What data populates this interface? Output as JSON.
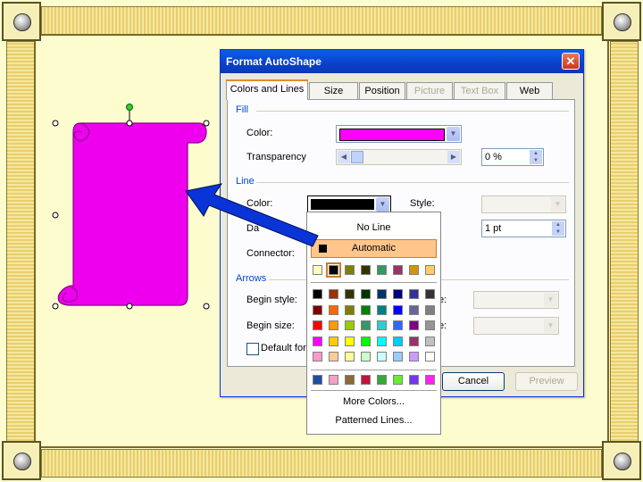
{
  "dialog": {
    "title": "Format AutoShape",
    "close_glyph": "✕",
    "tabs": [
      {
        "label": "Colors and Lines"
      },
      {
        "label": "Size"
      },
      {
        "label": "Position"
      },
      {
        "label": "Picture"
      },
      {
        "label": "Text Box"
      },
      {
        "label": "Web"
      }
    ],
    "fill": {
      "section": "Fill",
      "color_label": "Color:",
      "color_value": "#ff00ff",
      "transparency_label": "Transparency",
      "transparency_value": "0 %"
    },
    "line": {
      "section": "Line",
      "color_label": "Color:",
      "color_value": "#000000",
      "style_label": "Style:",
      "dashed_label": "Da",
      "weight_value": "1 pt",
      "connector_label": "Connector:"
    },
    "arrows": {
      "section": "Arrows",
      "begin_style_label": "Begin style:",
      "begin_size_label": "Begin size:",
      "end_style_suffix": "e:",
      "end_size_suffix": "e:"
    },
    "default_label": "Default for",
    "cancel_label": "Cancel",
    "preview_label": "Preview"
  },
  "palette": {
    "no_line": "No Line",
    "automatic": "Automatic",
    "more_colors": "More Colors...",
    "patterned_lines": "Patterned Lines...",
    "recent": [
      "#fffbc0",
      "#000000",
      "#808000",
      "#333300",
      "#339966",
      "#993366",
      "#cc9900",
      "#ffcc66"
    ],
    "grid": [
      [
        "#000000",
        "#993300",
        "#333300",
        "#003300",
        "#003366",
        "#000080",
        "#333399",
        "#333333"
      ],
      [
        "#800000",
        "#ff6600",
        "#808000",
        "#008000",
        "#008080",
        "#0000ff",
        "#666699",
        "#808080"
      ],
      [
        "#ff0000",
        "#ff9900",
        "#99cc00",
        "#339966",
        "#33cccc",
        "#3366ff",
        "#800080",
        "#969696"
      ],
      [
        "#ff00ff",
        "#ffcc00",
        "#ffff00",
        "#00ff00",
        "#00ffff",
        "#00ccff",
        "#993366",
        "#c0c0c0"
      ],
      [
        "#ff99cc",
        "#ffcc99",
        "#ffff99",
        "#ccffcc",
        "#ccffff",
        "#99ccff",
        "#cc99ff",
        "#ffffff"
      ]
    ],
    "scheme": [
      "#1f4e9e",
      "#f2a2c2",
      "#8c6a3c",
      "#c0143c",
      "#33aa33",
      "#66ee33",
      "#7733ee",
      "#ff22ee"
    ]
  },
  "shape": {
    "fill": "#ee00ee",
    "stroke": "#8a008a"
  },
  "arrow_color": "#0a34d8"
}
